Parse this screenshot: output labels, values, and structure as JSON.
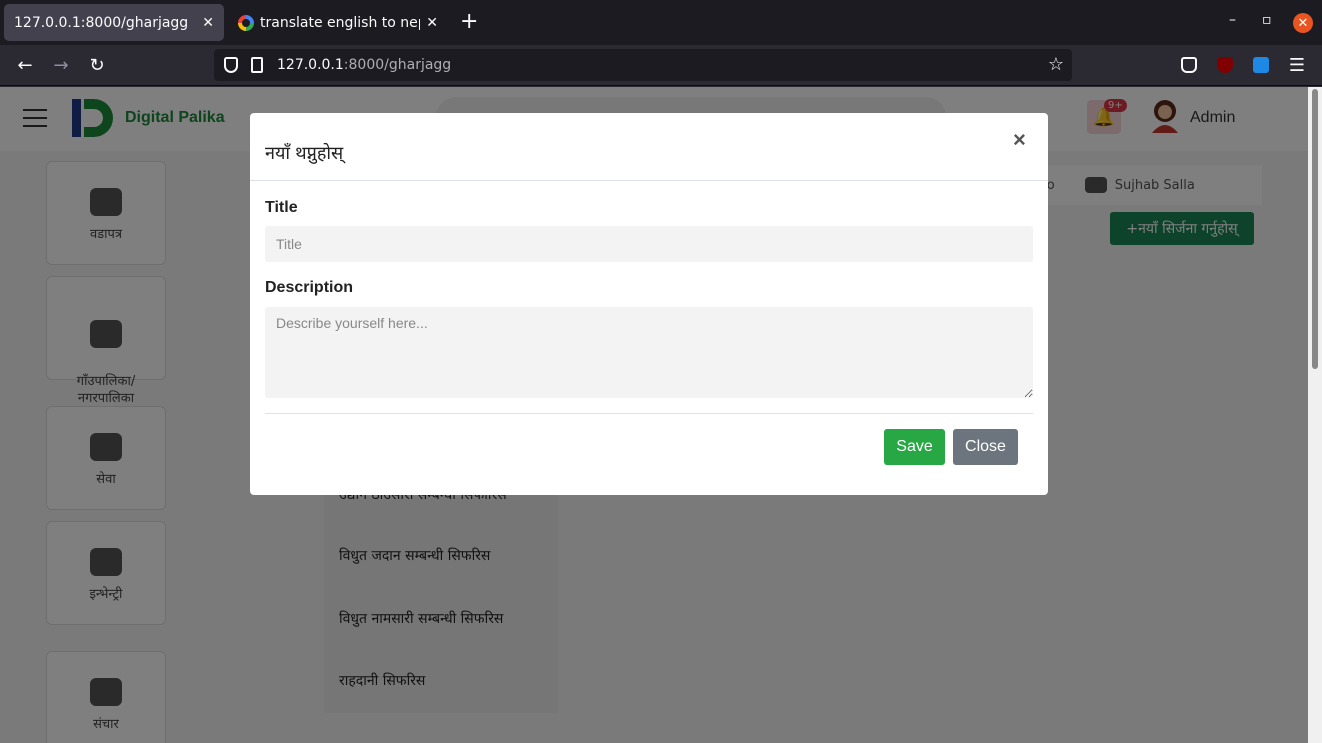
{
  "browser": {
    "tabs": [
      {
        "title": "127.0.0.1:8000/gharjagg",
        "active": true
      },
      {
        "title": "translate english to nepal",
        "active": false
      }
    ],
    "url": {
      "host": "127.0.0.1",
      "path": ":8000/gharjagg"
    }
  },
  "app": {
    "brand": "Digital Palika",
    "notification_count": "9+",
    "user_name": "Admin"
  },
  "sidebar": {
    "items": [
      {
        "label": "वडापत्र"
      },
      {
        "label": "गाँउपालिका/\nनगरपालिका"
      },
      {
        "label": "सेवा"
      },
      {
        "label": "इन्भेन्ट्री"
      },
      {
        "label": "संचार"
      }
    ]
  },
  "breadcrumb": {
    "partial": "so",
    "user": "Sujhab Salla"
  },
  "main": {
    "create_button": "+नयाँ सिर्जना गर्नुहोस्",
    "list": [
      "उद्योग ठाउँसारी सम्बन्धी सिफारिस",
      "विधुत जदान सम्बन्धी सिफरिस",
      "विधुत नामसारी सम्बन्धी सिफरिस",
      "राहदानी सिफरिस"
    ]
  },
  "modal": {
    "title": "नयाँ थप्नुहोस्",
    "fields": {
      "title_label": "Title",
      "title_placeholder": "Title",
      "description_label": "Description",
      "description_placeholder": "Describe yourself here..."
    },
    "save_label": "Save",
    "close_label": "Close",
    "close_icon": "×"
  },
  "colors": {
    "save": "#28a745",
    "close": "#6c757d",
    "brand": "#1a8a3a",
    "create": "#198754"
  }
}
